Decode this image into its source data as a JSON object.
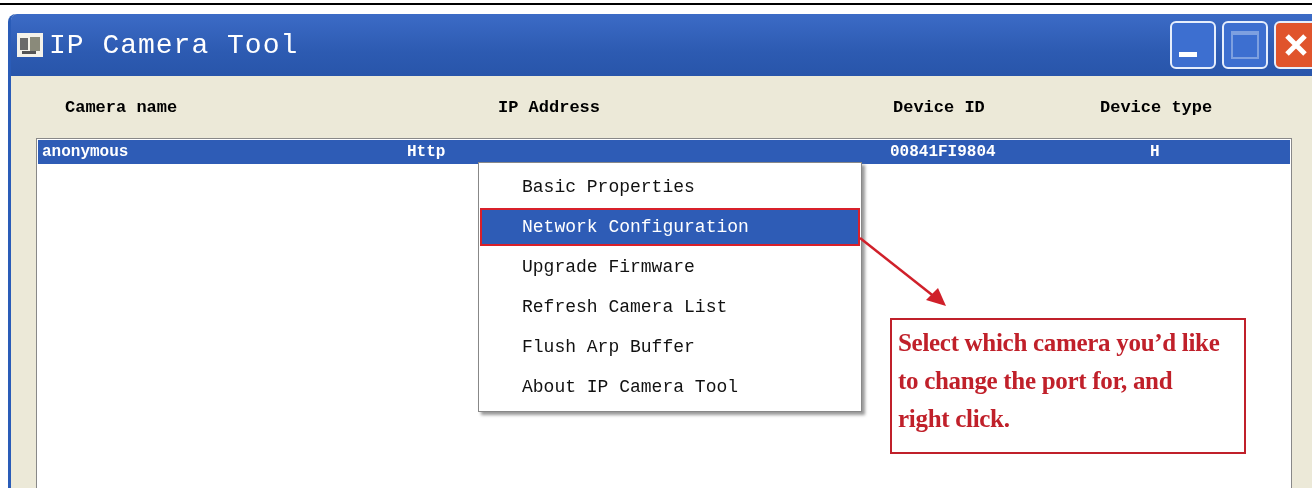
{
  "window": {
    "title": "IP Camera Tool"
  },
  "table": {
    "columns": [
      "Camera name",
      "IP Address",
      "Device ID",
      "Device type"
    ],
    "rows": [
      {
        "cells": [
          "anonymous",
          "Http",
          "00841FI9804",
          "H"
        ],
        "selected": true
      }
    ]
  },
  "context_menu": {
    "items": [
      {
        "label": "Basic Properties",
        "selected": false
      },
      {
        "label": "Network Configuration",
        "selected": true
      },
      {
        "label": "Upgrade Firmware",
        "selected": false
      },
      {
        "label": "Refresh Camera List",
        "selected": false
      },
      {
        "label": "Flush Arp Buffer",
        "selected": false
      },
      {
        "label": "About IP Camera Tool",
        "selected": false
      }
    ]
  },
  "annotation": {
    "text": "Select which camera you’d like to change the port for, and right click."
  }
}
